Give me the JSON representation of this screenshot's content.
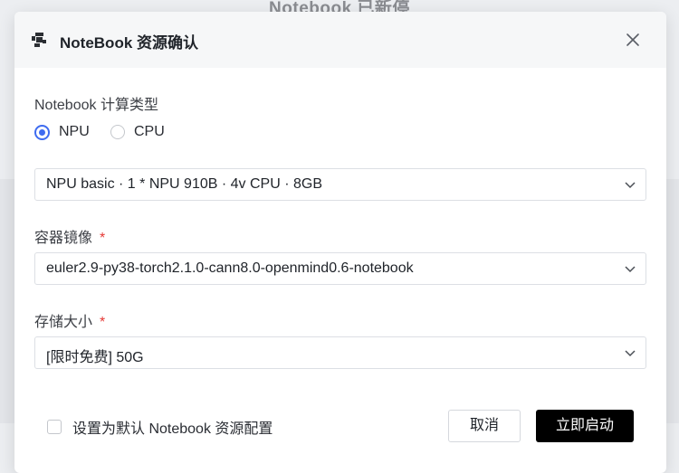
{
  "background": {
    "title": "Notebook 已新停"
  },
  "dialog": {
    "title": "NoteBook 资源确认",
    "logo_icon": "notebook-logo-icon",
    "close_icon": "close-icon"
  },
  "compute": {
    "label": "Notebook 计算类型",
    "options": [
      {
        "label": "NPU",
        "checked": true
      },
      {
        "label": "CPU",
        "checked": false
      }
    ],
    "spec_value": "NPU basic · 1 * NPU 910B · 4v CPU · 8GB"
  },
  "image": {
    "label": "容器镜像",
    "required_mark": "*",
    "value": "euler2.9-py38-torch2.1.0-cann8.0-openmind0.6-notebook"
  },
  "storage": {
    "label": "存储大小",
    "required_mark": "*",
    "value": "[限时免费] 50G"
  },
  "footer": {
    "default_checkbox_label": "设置为默认 Notebook 资源配置",
    "default_checked": false,
    "cancel_label": "取消",
    "start_label": "立即启动"
  },
  "colors": {
    "accent": "#3f6cf0",
    "primary_button": "#000000",
    "required": "#e53935"
  }
}
